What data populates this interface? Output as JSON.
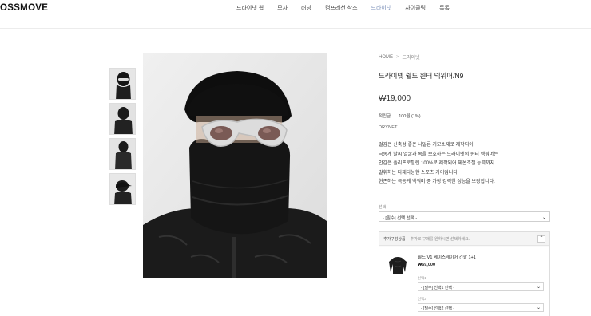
{
  "header": {
    "logo": "OSSMOVE",
    "nav": [
      {
        "label": "드라이넷 웜",
        "active": false
      },
      {
        "label": "모자",
        "active": false
      },
      {
        "label": "러닝",
        "active": false
      },
      {
        "label": "컴프레션 삭스",
        "active": false
      },
      {
        "label": "드라이넷",
        "active": true
      },
      {
        "label": "사이클링",
        "active": false
      },
      {
        "label": "톡톡",
        "active": false
      }
    ]
  },
  "breadcrumb": {
    "home": "HOME",
    "sep": ">",
    "current": "드라이넷"
  },
  "product": {
    "title": "드라이넷 쉴드 윈터 넥워머/N9",
    "price": "₩19,000",
    "points_label": "적립금",
    "points_value": "100원 (1%)",
    "brand": "DRYNET",
    "description": [
      "걸감은 신축성 좋은 나일론 기모소재로 제작되어",
      "극동계 날씨 얼굴과 목을 보호하는 드라이넷의 윈터 넥워머는",
      "안감은 폴리프로필렌 100%로 제작되어 체온조절 능력까지",
      "발휘하는 다재다능한 스포츠 기어입니다.",
      "현존하는 극동계 넥워머 중 가장 강력한 성능을 보장합니다."
    ],
    "option_label": "선택",
    "option_value": "- [필수] 선택 선택 -"
  },
  "addon": {
    "title": "추가구성상품",
    "subtitle": "추가로 구매를 원하시면 선택하세요.",
    "toggle": "⌃",
    "item_name": "쉴드 V1 베이스레이어 긴팔 1+1",
    "item_price": "₩69,000",
    "opt1_label": "선택1",
    "opt1_value": "- [필수] 선택1 선택 -",
    "opt2_label": "선택2",
    "opt2_value": "- [필수] 선택2 선택 -"
  },
  "icons": {
    "chevron": "chevron-down-icon"
  }
}
